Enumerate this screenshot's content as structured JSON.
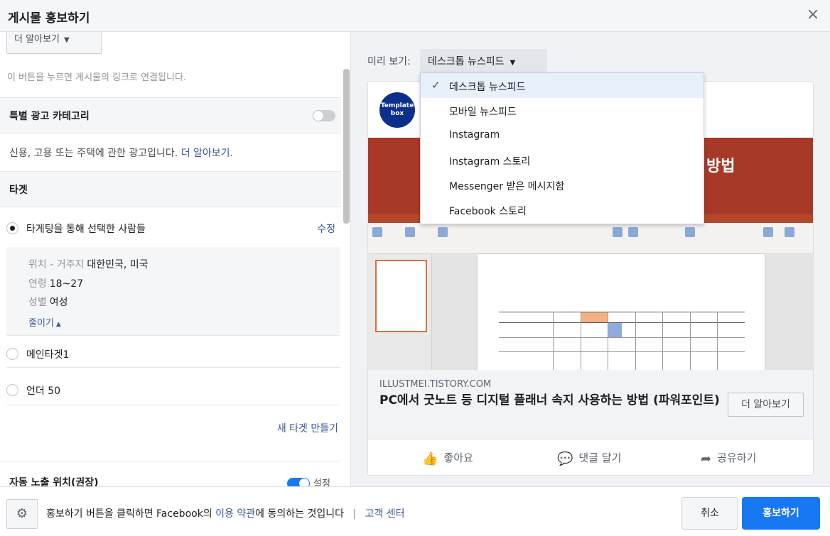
{
  "header": {
    "title": "게시물 홍보하기",
    "close_icon": "close-icon"
  },
  "left": {
    "more_button": "더 알아보기",
    "link_note": "이 버튼을 누르면 게시물의 링크로 연결됩니다.",
    "special_category": {
      "label": "특별 광고 카테고리",
      "enabled": false
    },
    "credit_note": "신용, 고용 또는 주택에 관한 광고입니다.",
    "credit_learn": "더 알아보기.",
    "target_section": "타겟",
    "targets": [
      {
        "label": "타게팅을 통해 선택한 사람들",
        "selected": true,
        "edit": "수정"
      },
      {
        "label": "메인타겟1",
        "selected": false
      },
      {
        "label": "언더 50",
        "selected": false
      }
    ],
    "detail": {
      "location_key": "위치 - 거주지",
      "location_val": "대한민국, 미국",
      "age_key": "연령",
      "age_val": "18~27",
      "gender_key": "성별",
      "gender_val": "여성",
      "collapse": "줄이기"
    },
    "new_target": "새 타겟 만들기",
    "auto_placement": {
      "label": "자동 노출 위치(권장)",
      "state": "설정",
      "enabled": true
    }
  },
  "preview": {
    "label": "미리 보기:",
    "selected": "데스크톱 뉴스피드",
    "options": [
      "데스크톱 뉴스피드",
      "모바일 뉴스피드",
      "Instagram",
      "Instagram 스토리",
      "Messenger 받은 메시지함",
      "Facebook 스토리"
    ],
    "card": {
      "avatar_text_1": "Template",
      "avatar_text_2": "box",
      "banner_text": "방법",
      "domain": "ILLUSTMEI.TISTORY.COM",
      "title": "PC에서 굿노트 등 디지털 플래너 속지 사용하는 방법 (파워포인트)",
      "learn_more": "더 알아보기",
      "actions": [
        "좋아요",
        "댓글 달기",
        "공유하기"
      ]
    }
  },
  "footer": {
    "terms_prefix": "홍보하기 버튼을 클릭하면 Facebook의",
    "terms_link": "이용 약관",
    "terms_suffix": "에 동의하는 것입니다",
    "help_link": "고객 센터",
    "cancel": "취소",
    "promote": "홍보하기"
  },
  "colors": {
    "accent": "#1877f2",
    "link": "#385898",
    "banner": "#a83828"
  }
}
